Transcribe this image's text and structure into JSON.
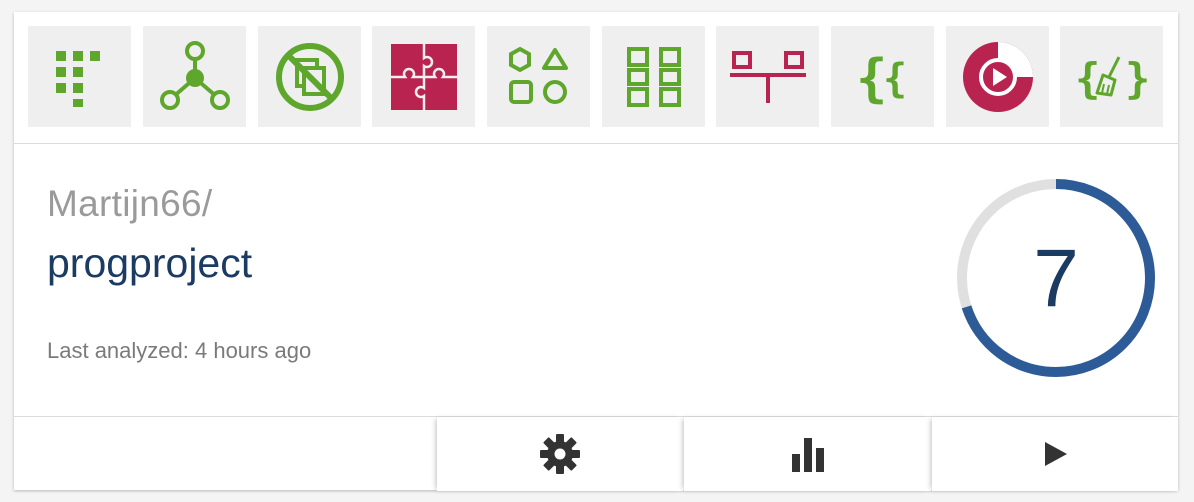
{
  "colors": {
    "green": "#5fa72c",
    "red": "#b9234f",
    "navy": "#1c3b63",
    "ring_blue": "#2c5b97",
    "ring_track": "#e0e0e0",
    "tile_bg": "#efefef"
  },
  "badges": [
    {
      "icon": "green-squares-grid-icon"
    },
    {
      "icon": "node-graph-icon"
    },
    {
      "icon": "no-duplicate-copy-icon"
    },
    {
      "icon": "puzzle-icon"
    },
    {
      "icon": "shapes-grid-icon"
    },
    {
      "icon": "modules-grid-icon"
    },
    {
      "icon": "dependency-connect-icon"
    },
    {
      "icon": "curly-braces-icon"
    },
    {
      "icon": "play-circle-icon"
    },
    {
      "icon": "clean-code-broom-icon"
    }
  ],
  "repo": {
    "owner": "Martijn66/",
    "name": "progproject",
    "last_analyzed": "Last analyzed: 4 hours ago"
  },
  "score": {
    "value": "7",
    "fraction": 0.7
  },
  "footer": {
    "buttons": [
      {
        "icon": "gear-icon"
      },
      {
        "icon": "bar-chart-icon"
      },
      {
        "icon": "play-icon"
      }
    ]
  }
}
